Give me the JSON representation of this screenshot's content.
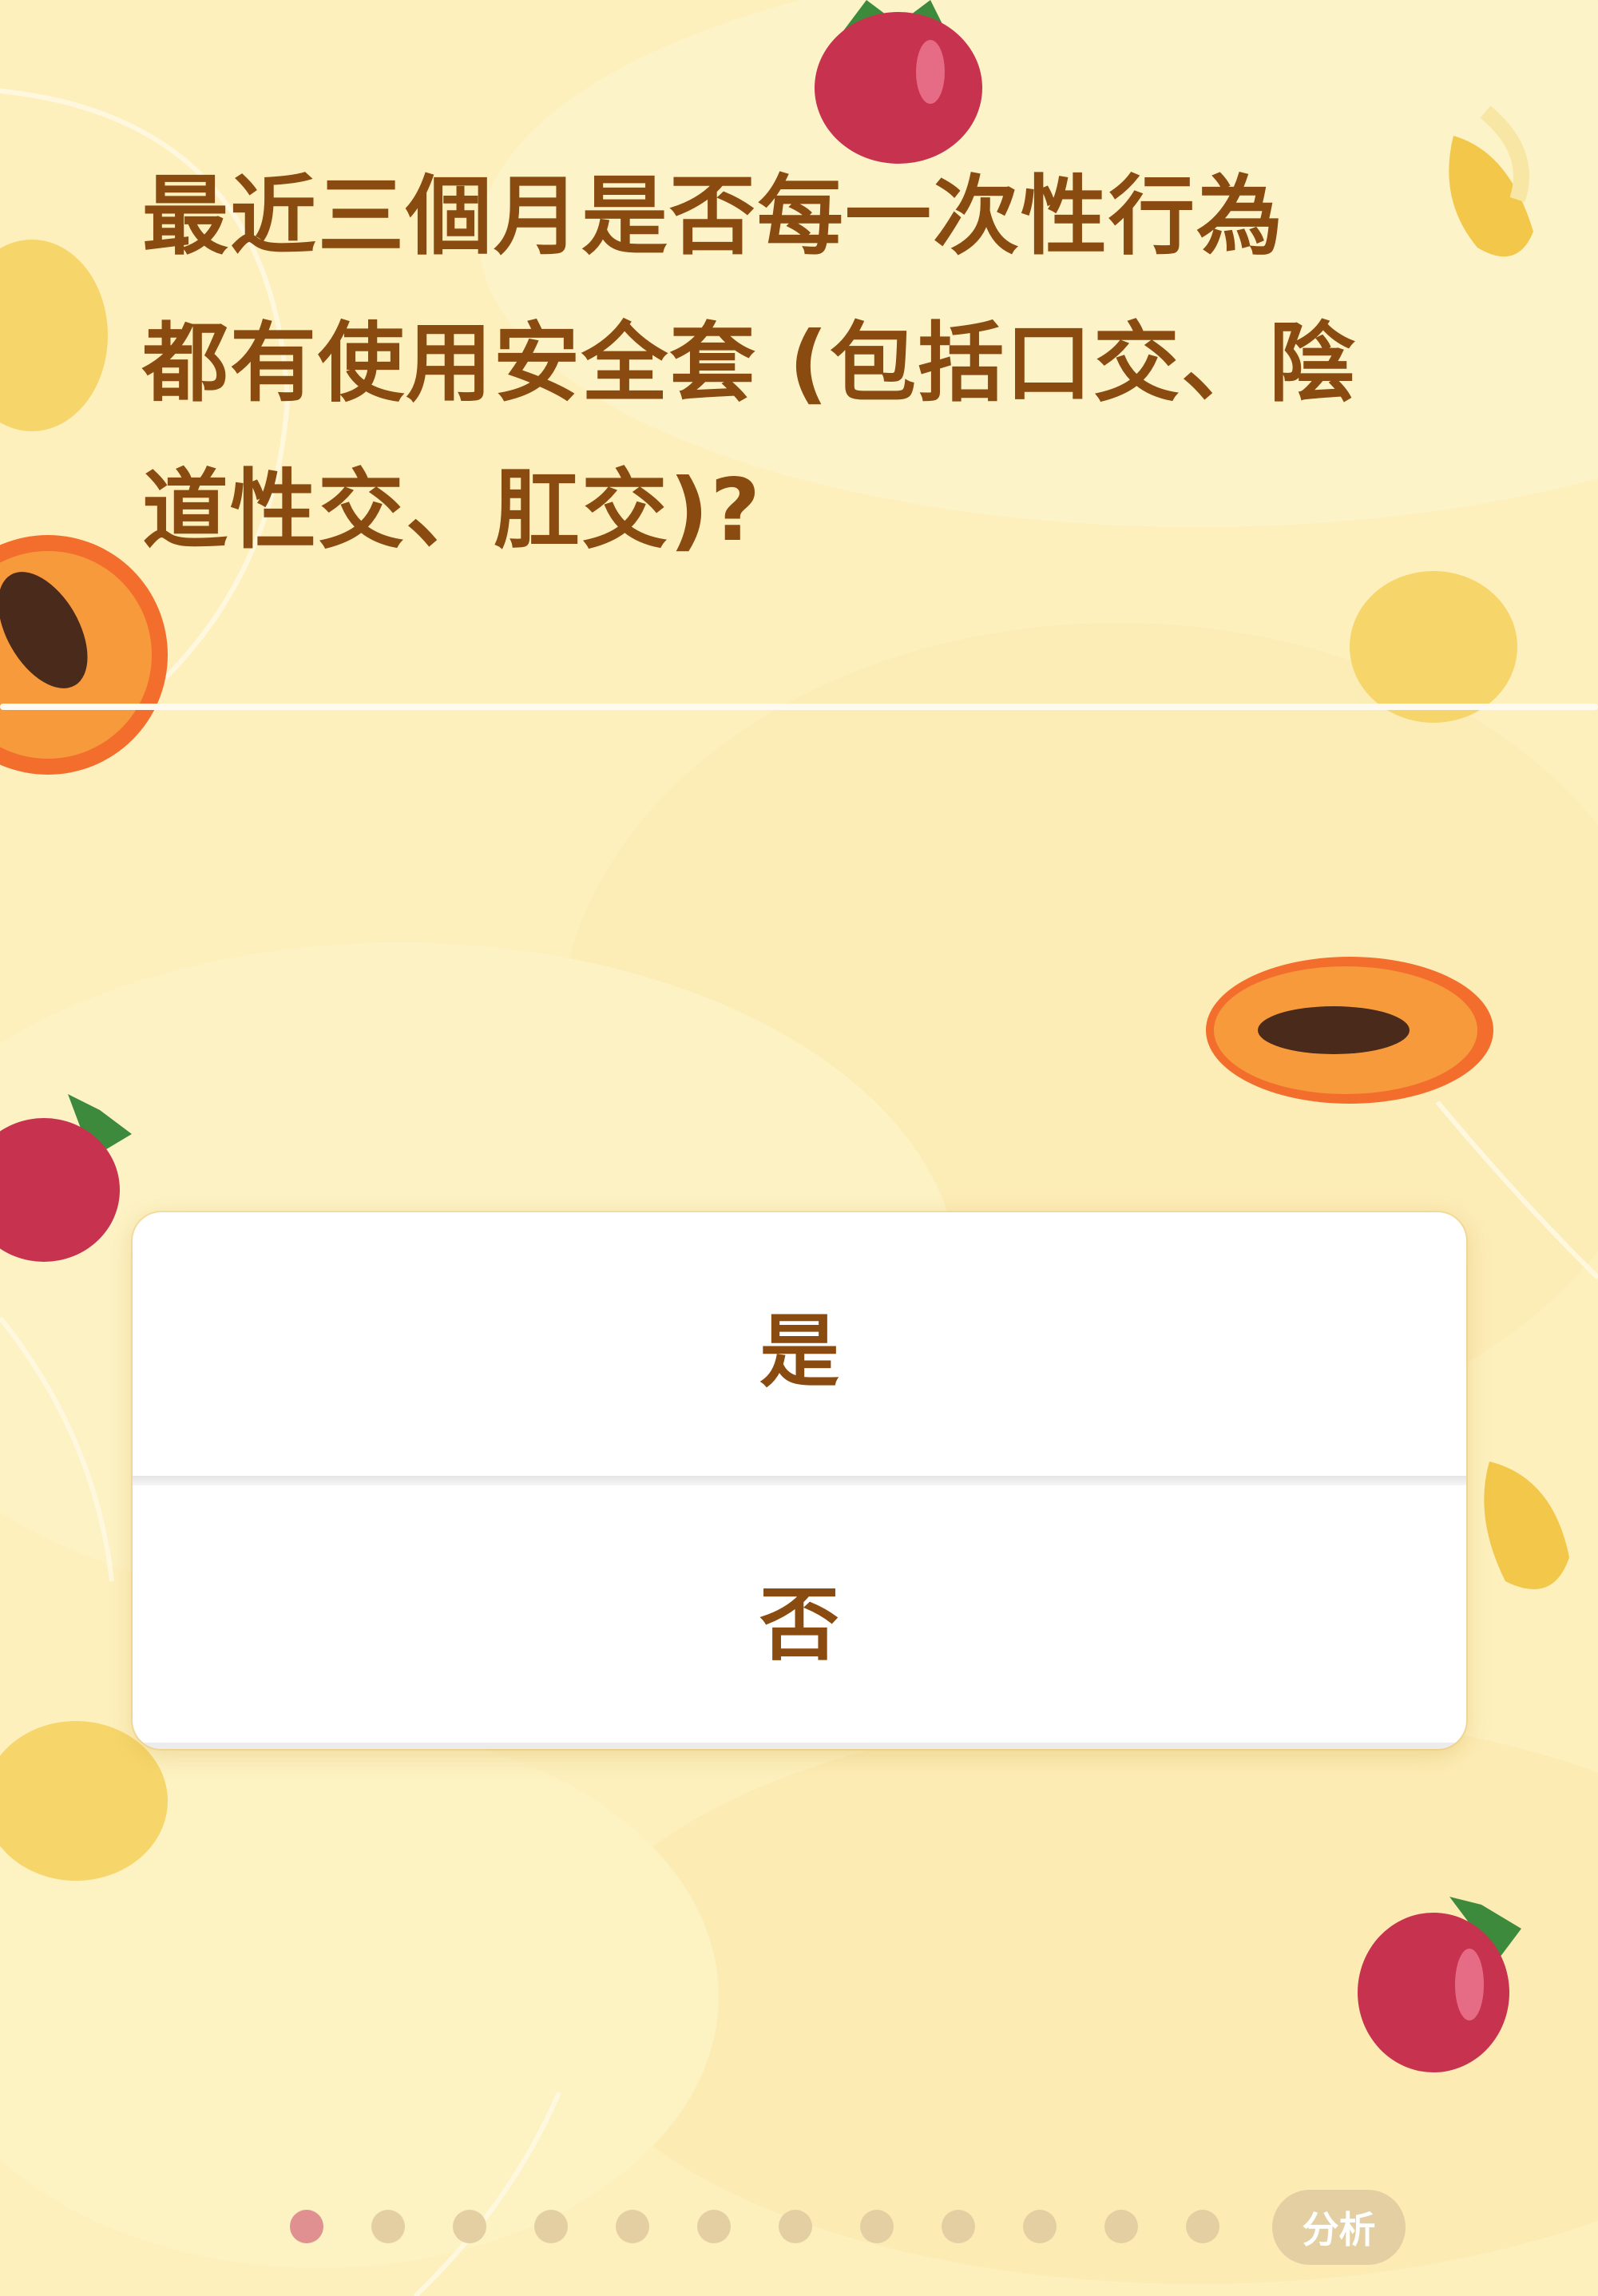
{
  "question": {
    "line1": "最近三個月是否每一次性行為",
    "line2": "都有使用安全套 (包括口交、陰",
    "line3": "道性交、肛交)?"
  },
  "answers": [
    {
      "label": "是"
    },
    {
      "label": "否"
    }
  ],
  "pagination": {
    "total_dots": 12,
    "active_index": 0,
    "analyze_label": "分析"
  },
  "colors": {
    "background": "#fdf0bd",
    "text": "#8a4b10",
    "dot": "#e3cfa2",
    "active_dot": "#e09090"
  },
  "decorations": [
    "strawberry-icon",
    "lemon-icon",
    "papaya-icon",
    "banana-icon"
  ]
}
